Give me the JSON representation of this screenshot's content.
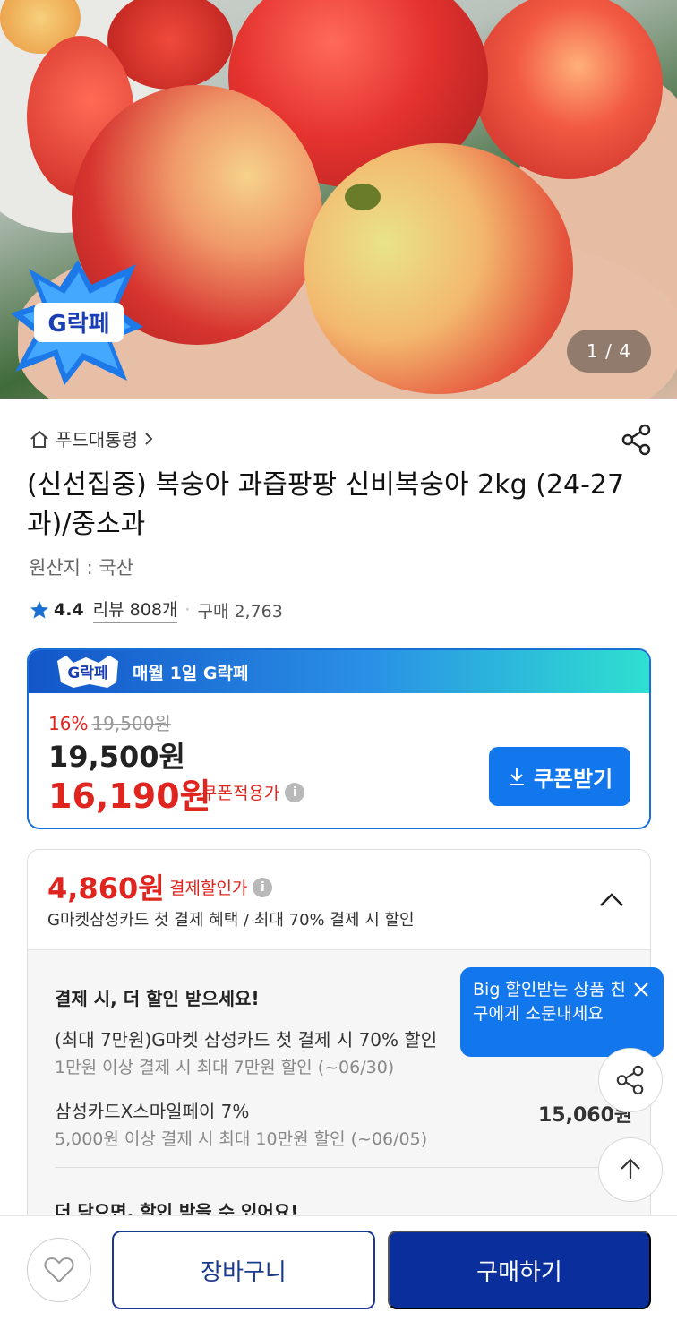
{
  "hero": {
    "image_counter": "1 / 4",
    "badge_text": "G락페"
  },
  "breadcrumb": {
    "store": "푸드대통령"
  },
  "product": {
    "title": "(신선집중) 복숭아 과즙팡팡 신비복숭아 2kg (24-27과)/중소과",
    "origin": "원산지 : 국산",
    "rating": "4.4",
    "review_label": "리뷰 808개",
    "purchase_count": "구매 2,763"
  },
  "price_card": {
    "banner_logo": "G락페",
    "banner_text": "매월 1일 G락페",
    "discount_rate": "16%",
    "original_price": "19,500원",
    "sale_price": "19,500원",
    "coupon_price": "16,190원",
    "coupon_price_label": "쿠폰적용가",
    "coupon_button": "쿠폰받기"
  },
  "payment": {
    "price": "4,860원",
    "label": "결제할인가",
    "subtitle": "G마켓삼성카드 첫 결제 혜택 / 최대 70% 결제 시 할인",
    "heading": "결제 시, 더 할인 받으세요!",
    "offer1": "(최대 7만원)G마켓 삼성카드 첫 결제 시 70% 할인",
    "offer1_sub": "1만원 이상 결제 시 최대 7만원 할인 (~06/30)",
    "offer2": "삼성카드X스마일페이 7%",
    "offer2_price": "15,060원",
    "offer2_sub": "5,000원 이상 결제 시 최대 10만원 할인 (~06/05)",
    "heading2": "더 담으면, 할인 받을 수 있어요!"
  },
  "tooltip": {
    "text": "Big 할인받는 상품 친구에게 소문내세요"
  },
  "bottom_bar": {
    "cart": "장바구니",
    "buy": "구매하기"
  },
  "colors": {
    "primary_blue": "#1277ec",
    "navy": "#0a2f9c",
    "sale_red": "#e0241e",
    "star_blue": "#1a6fd4"
  }
}
